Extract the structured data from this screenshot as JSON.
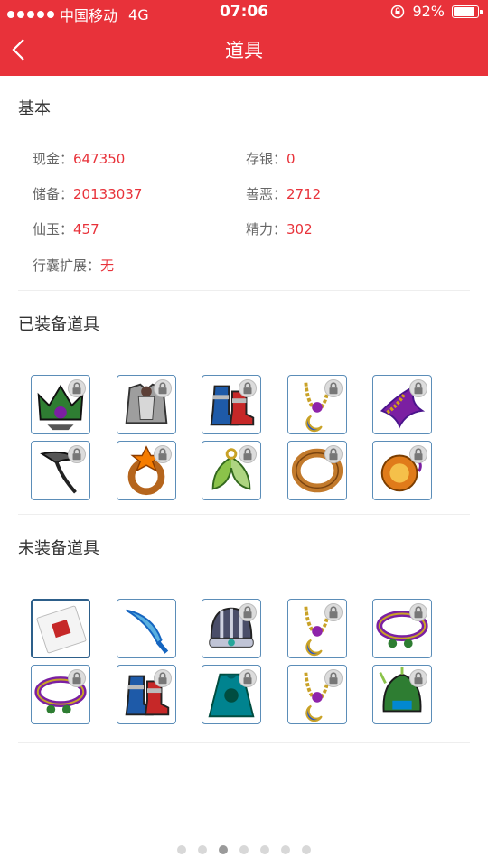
{
  "status_bar": {
    "carrier": "中国移动",
    "network": "4G",
    "time": "07:06",
    "battery": "92%",
    "battery_level": 0.92
  },
  "header": {
    "title": "道具"
  },
  "basic": {
    "title": "基本",
    "cash": {
      "label": "现金：",
      "value": "647350"
    },
    "deposit": {
      "label": "存银：",
      "value": "0"
    },
    "reserve": {
      "label": "储备：",
      "value": "20133037"
    },
    "karma": {
      "label": "善恶：",
      "value": "2712"
    },
    "jade": {
      "label": "仙玉：",
      "value": "457"
    },
    "energy": {
      "label": "精力：",
      "value": "302"
    },
    "bag": {
      "label": "行囊扩展：",
      "value": "无"
    }
  },
  "equipped": {
    "title": "已装备道具",
    "items": [
      {
        "icon": "helmet-icon",
        "locked": true
      },
      {
        "icon": "armor-icon",
        "locked": true
      },
      {
        "icon": "boots-icon",
        "locked": true
      },
      {
        "icon": "necklace-icon",
        "locked": true
      },
      {
        "icon": "ribbon-icon",
        "locked": true
      },
      {
        "icon": "scythe-icon",
        "locked": true
      },
      {
        "icon": "flower-ring-icon",
        "locked": true
      },
      {
        "icon": "leaf-pendant-icon",
        "locked": true
      },
      {
        "icon": "ring-icon",
        "locked": true
      },
      {
        "icon": "amulet-icon",
        "locked": true
      }
    ]
  },
  "unequipped": {
    "title": "未装备道具",
    "items": [
      {
        "icon": "talisman-paper-icon",
        "locked": false,
        "selected": true
      },
      {
        "icon": "blade-icon",
        "locked": false
      },
      {
        "icon": "hat-icon",
        "locked": true
      },
      {
        "icon": "necklace-icon",
        "locked": true
      },
      {
        "icon": "green-belt-icon",
        "locked": true
      },
      {
        "icon": "green-belt-icon",
        "locked": true
      },
      {
        "icon": "boots-icon",
        "locked": true
      },
      {
        "icon": "cloak-icon",
        "locked": true
      },
      {
        "icon": "necklace-icon",
        "locked": true
      },
      {
        "icon": "dragon-helmet-icon",
        "locked": true
      }
    ]
  },
  "pager": {
    "count": 7,
    "active_index": 2
  },
  "colors": {
    "accent": "#e8323a",
    "item_border": "#5b8db8"
  }
}
